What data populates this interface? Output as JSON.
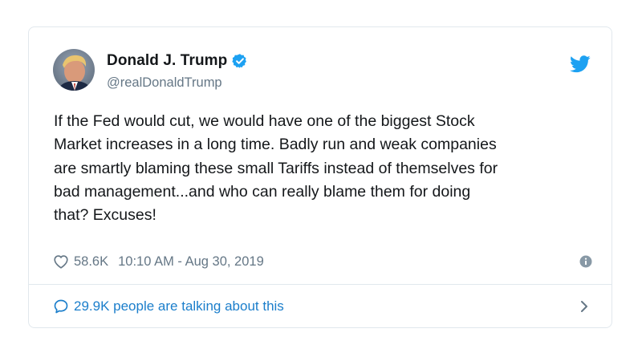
{
  "tweet": {
    "author": {
      "display_name": "Donald J. Trump",
      "handle": "@realDonaldTrump",
      "verified": true
    },
    "text": "If the Fed would cut, we would have one of the biggest Stock\nMarket increases in a long time. Badly run and weak companies\nare smartly blaming these small Tariffs instead of themselves for\nbad management...and who can really blame them for doing\nthat? Excuses!",
    "likes": "58.6K",
    "timestamp": "10:10 AM - Aug 30, 2019",
    "talking": "29.9K people are talking about this"
  },
  "icons": {
    "bird": "twitter-bird-icon",
    "verified": "verified-badge-icon",
    "heart": "heart-icon",
    "info": "info-icon",
    "bubble": "speech-bubble-icon",
    "chevron": "chevron-right-icon"
  },
  "colors": {
    "brand_blue": "#1da1f2",
    "link_blue": "#1b7ecb",
    "text": "#14171a",
    "muted": "#657786",
    "border": "#e1e8ed"
  }
}
